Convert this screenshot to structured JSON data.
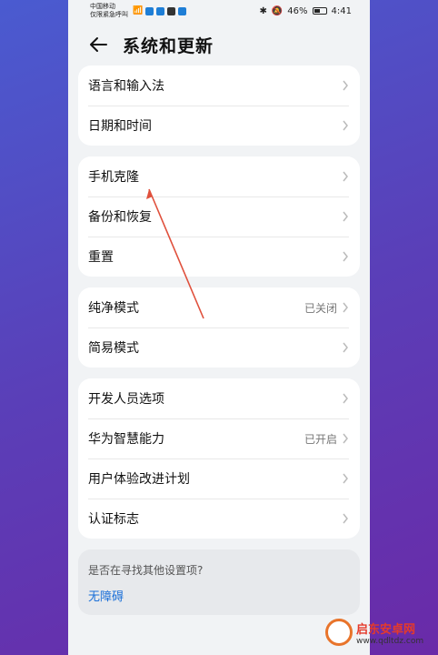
{
  "status_bar": {
    "carrier_line1": "中国移动",
    "carrier_line2": "仅限紧急呼叫",
    "battery_percent": "46%",
    "time": "4:41"
  },
  "header": {
    "title": "系统和更新"
  },
  "groups": [
    {
      "items": [
        {
          "label": "语言和输入法"
        },
        {
          "label": "日期和时间"
        }
      ]
    },
    {
      "items": [
        {
          "label": "手机克隆"
        },
        {
          "label": "备份和恢复"
        },
        {
          "label": "重置"
        }
      ]
    },
    {
      "items": [
        {
          "label": "纯净模式",
          "value": "已关闭"
        },
        {
          "label": "简易模式"
        }
      ]
    },
    {
      "items": [
        {
          "label": "开发人员选项"
        },
        {
          "label": "华为智慧能力",
          "value": "已开启"
        },
        {
          "label": "用户体验改进计划"
        },
        {
          "label": "认证标志"
        }
      ]
    }
  ],
  "search_card": {
    "question": "是否在寻找其他设置项?",
    "link": "无障碍"
  },
  "watermark": {
    "name": "启东安卓网",
    "url": "www.qdltdz.com"
  },
  "colors": {
    "link": "#1a6fd8",
    "annotation_arrow": "#e0503c"
  }
}
